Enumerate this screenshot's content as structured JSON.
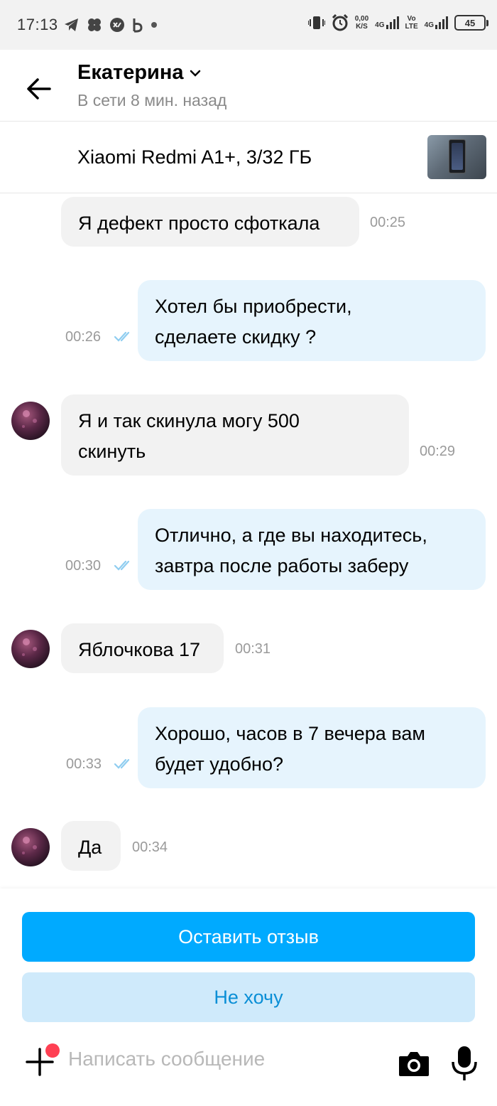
{
  "status_bar": {
    "time": "17:13",
    "speed_value": "0,00",
    "speed_unit": "K/S",
    "network_1": "4G",
    "volte_top": "Vo",
    "volte_bottom": "LTE",
    "network_2": "4G",
    "battery": "45"
  },
  "header": {
    "contact_name": "Екатерина",
    "contact_status": "В сети 8 мин. назад"
  },
  "item": {
    "title": "Xiaomi Redmi A1+, 3/32 ГБ"
  },
  "messages": [
    {
      "direction": "in",
      "lines": [
        "Я дефект просто сфоткала"
      ],
      "time": "00:25"
    },
    {
      "direction": "out",
      "lines": [
        "Хотел бы приобрести,",
        "сделаете скидку ?"
      ],
      "time": "00:26"
    },
    {
      "direction": "in",
      "lines": [
        "Я и так скинула могу 500",
        "скинуть"
      ],
      "time": "00:29"
    },
    {
      "direction": "out",
      "lines": [
        "Отлично, а где вы находитесь,",
        "завтра после работы заберу"
      ],
      "time": "00:30"
    },
    {
      "direction": "in",
      "lines": [
        "Яблочкова 17"
      ],
      "time": "00:31"
    },
    {
      "direction": "out",
      "lines": [
        "Хорошо, часов в 7 вечера вам",
        "будет удобно?"
      ],
      "time": "00:33"
    },
    {
      "direction": "in",
      "lines": [
        "Да"
      ],
      "time": "00:34"
    }
  ],
  "actions": {
    "review_button": "Оставить отзыв",
    "decline_button": "Не хочу"
  },
  "composer": {
    "placeholder": "Написать сообщение"
  },
  "colors": {
    "accent": "#00aaff",
    "secondary_button_bg": "#cfeafb",
    "incoming_bubble": "#f2f2f2",
    "outgoing_bubble": "#e6f4fd",
    "notification_dot": "#ff4053"
  }
}
